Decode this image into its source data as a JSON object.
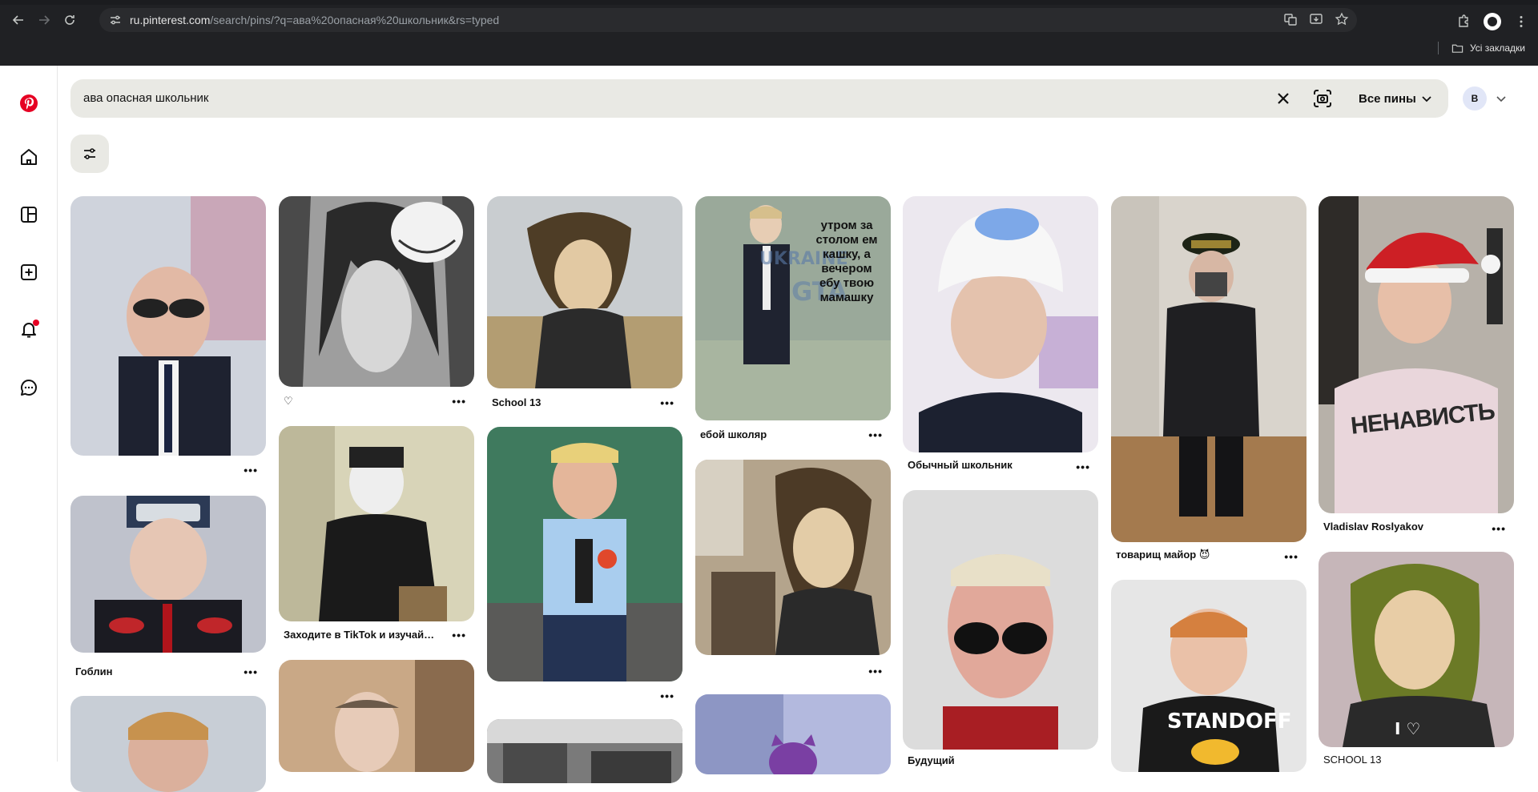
{
  "browser": {
    "url_host": "ru.pinterest.com",
    "url_path": "/search/pins/?q=ава%20опасная%20школьник&rs=typed",
    "bookmarks_label": "Усі закладки"
  },
  "search": {
    "query": "ава опасная школьник",
    "filter_label": "Все пины",
    "avatar_letter": "B"
  },
  "pins": [
    {
      "title": "",
      "col": 0
    },
    {
      "title": "Гоблин",
      "col": 0
    },
    {
      "title": "",
      "col": 0
    },
    {
      "title": "♡",
      "col": 1
    },
    {
      "title": "Заходите в TikTok и изучайте...",
      "col": 1
    },
    {
      "title": "",
      "col": 1
    },
    {
      "title": "School 13",
      "col": 2
    },
    {
      "title": "",
      "col": 2
    },
    {
      "title": "",
      "col": 2
    },
    {
      "title": "ебой школяр",
      "col": 3,
      "overlay": "утром за столом ем кашку, а вечером ебу твою мамашку"
    },
    {
      "title": "",
      "col": 3
    },
    {
      "title": "",
      "col": 3
    },
    {
      "title": "Обычный школьник",
      "col": 4
    },
    {
      "title": "Будущий",
      "col": 4
    },
    {
      "title": "товарищ майор 😈",
      "col": 5
    },
    {
      "title": "",
      "col": 5
    },
    {
      "title": "Vladislav Roslyakov",
      "col": 6,
      "shirt_text": "НЕНАВИСТЬ"
    },
    {
      "title": "SCHOOL 13",
      "col": 6
    }
  ],
  "colors": {
    "brand": "#e60023",
    "search_bg": "#e9e9e4",
    "chrome_bg": "#202124"
  }
}
